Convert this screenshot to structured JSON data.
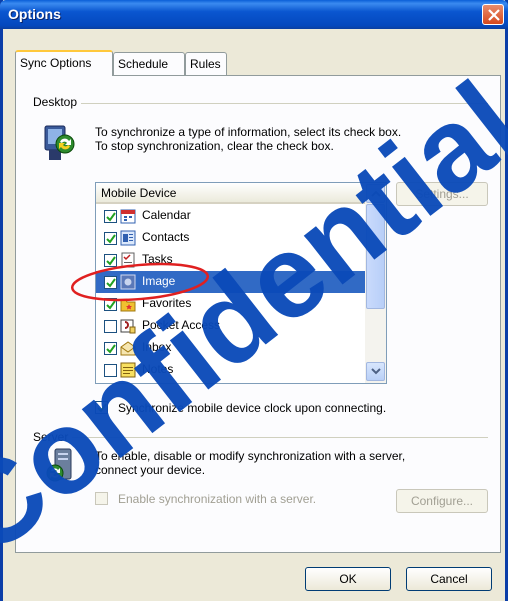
{
  "window": {
    "title": "Options"
  },
  "tabs": [
    {
      "label": "Sync Options",
      "active": true
    },
    {
      "label": "Schedule",
      "active": false
    },
    {
      "label": "Rules",
      "active": false
    }
  ],
  "desktop": {
    "group_label": "Desktop",
    "info_line1": "To synchronize a type of information, select its check box.",
    "info_line2": "To stop synchronization, clear the check box.",
    "list_header": "Mobile Device",
    "items": [
      {
        "label": "Calendar",
        "checked": true,
        "icon": "calendar-icon"
      },
      {
        "label": "Contacts",
        "checked": true,
        "icon": "contacts-icon"
      },
      {
        "label": "Tasks",
        "checked": true,
        "icon": "tasks-icon"
      },
      {
        "label": "Image",
        "checked": true,
        "icon": "image-icon",
        "selected": true
      },
      {
        "label": "Favorites",
        "checked": true,
        "icon": "favorites-icon"
      },
      {
        "label": "Pocket Access",
        "checked": false,
        "icon": "pocket-access-icon"
      },
      {
        "label": "Inbox",
        "checked": true,
        "icon": "inbox-icon"
      },
      {
        "label": "Notes",
        "checked": false,
        "icon": "notes-icon"
      }
    ],
    "settings_label": "Settings...",
    "clock_sync_label": "Synchronize mobile device clock upon connecting.",
    "clock_sync_checked": true
  },
  "server": {
    "group_label": "Server",
    "info_line1": "To enable, disable or modify synchronization with a server,",
    "info_line2": "connect your device.",
    "enable_label": "Enable synchronization with a server.",
    "configure_label": "Configure..."
  },
  "footer": {
    "ok_label": "OK",
    "cancel_label": "Cancel"
  },
  "watermark": {
    "text": "Confidential"
  },
  "colors": {
    "titlebar": "#0a56d0",
    "selection": "#316ac5",
    "annotation": "#e02020",
    "watermark": "#0a4ab8"
  }
}
